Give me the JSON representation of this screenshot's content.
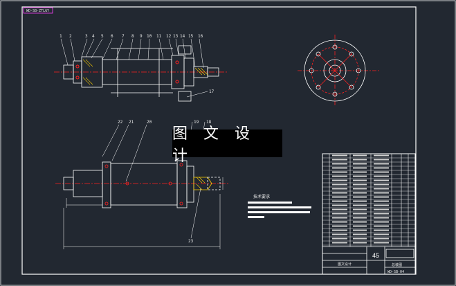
{
  "drawing": {
    "title_block_tag": "WD-SB-ZTLGY",
    "watermark": "图 文 设 计",
    "tech_req_title": "技术要求",
    "part_callouts_top": [
      "1",
      "2",
      "3",
      "4",
      "5",
      "6",
      "7",
      "8",
      "9",
      "10",
      "11",
      "12",
      "13",
      "14",
      "15",
      "16",
      "17"
    ],
    "part_callouts_bottom": [
      "22",
      "21",
      "20",
      "19",
      "18",
      "23"
    ],
    "title_block": {
      "scale": "45",
      "name": "总装图",
      "code": "WD-SB-04",
      "company": "图文设计"
    },
    "colors": {
      "background": "#222831",
      "line": "#ffffff",
      "center": "#ff2020",
      "hatch": "#ffd000",
      "dim": "#ff60ff",
      "tag": "#ff40ff"
    }
  }
}
